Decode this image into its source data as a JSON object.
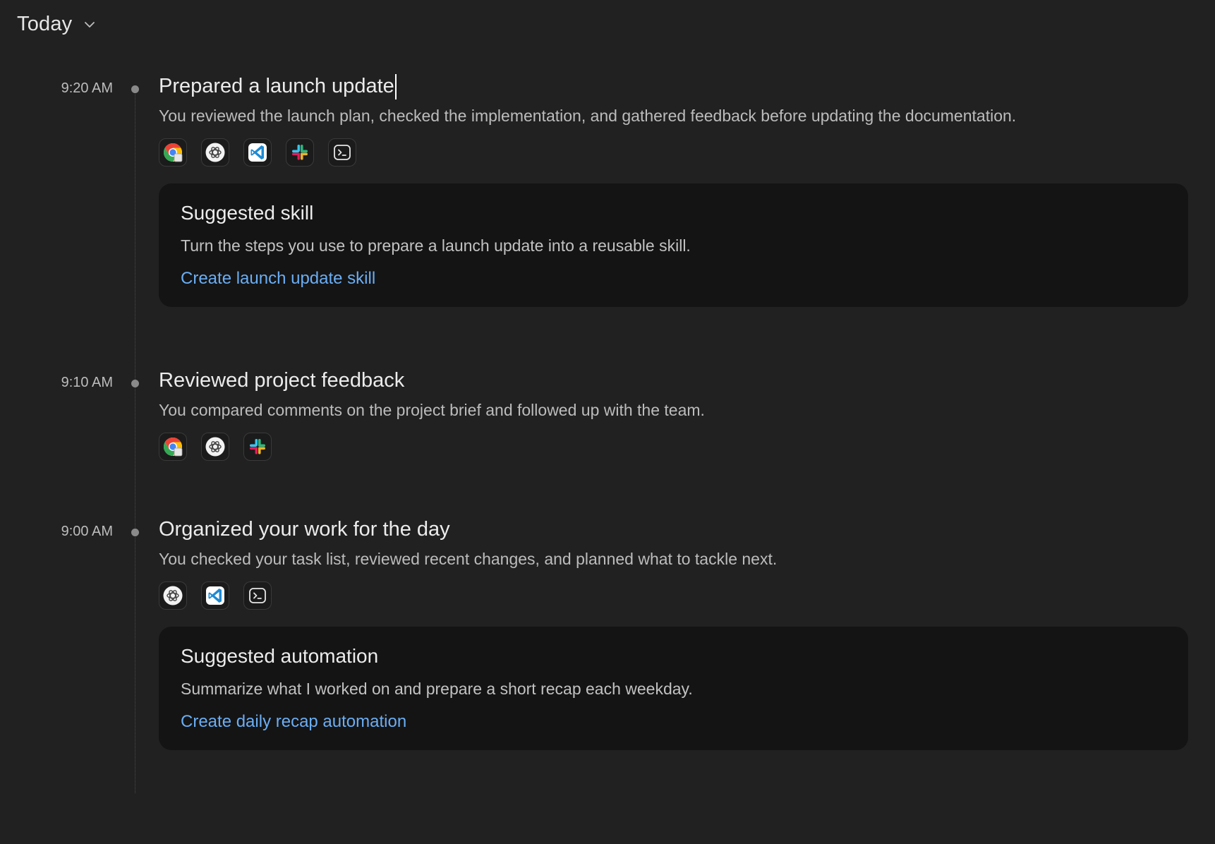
{
  "header": {
    "title": "Today"
  },
  "entries": [
    {
      "time": "9:20 AM",
      "title": "Prepared a launch update",
      "description": "You reviewed the launch plan, checked the implementation, and gathered feedback before updating the documentation.",
      "apps": [
        "chrome-icon",
        "chatgpt-icon",
        "vscode-icon",
        "slack-icon",
        "terminal-icon"
      ],
      "suggestion": {
        "title": "Suggested skill",
        "text": "Turn the steps you use to prepare a launch update into a reusable skill.",
        "link": "Create launch update skill"
      }
    },
    {
      "time": "9:10 AM",
      "title": "Reviewed project feedback",
      "description": "You compared comments on the project brief and followed up with the team.",
      "apps": [
        "chrome-icon",
        "chatgpt-icon",
        "slack-icon"
      ]
    },
    {
      "time": "9:00 AM",
      "title": "Organized your work for the day",
      "description": "You checked your task list, reviewed recent changes, and planned what to tackle next.",
      "apps": [
        "chatgpt-icon",
        "vscode-icon",
        "terminal-icon"
      ],
      "suggestion": {
        "title": "Suggested automation",
        "text": "Summarize what I worked on and prepare a short recap each weekday.",
        "link": "Create daily recap automation"
      }
    }
  ],
  "colors": {
    "background": "#212121",
    "card": "#141414",
    "link": "#6aaef5"
  }
}
